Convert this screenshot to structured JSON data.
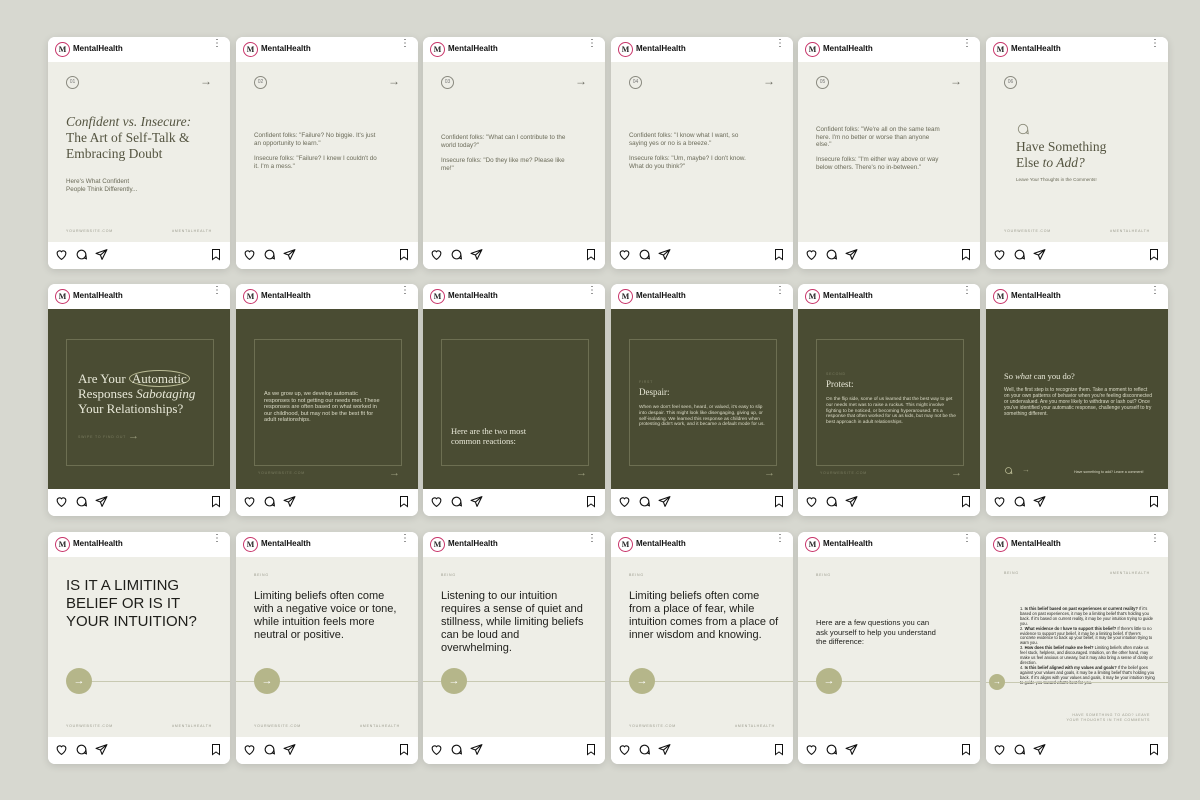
{
  "brand": {
    "avatar_letter": "M",
    "username": "MentalHealth",
    "kebab": "⋮"
  },
  "colors": {
    "background": "#d7d8d0",
    "light_post": "#eeeee7",
    "dark_post": "#4a4c33",
    "accent_circle": "#b5b68a",
    "avatar_ring": "#c8356a"
  },
  "icons": [
    "heart-icon",
    "comment-icon",
    "share-icon",
    "bookmark-icon"
  ],
  "row1": {
    "c1": {
      "num": "01",
      "arrow": "→",
      "title1": "Confident vs. Insecure:",
      "title2": "The Art of Self-Talk &",
      "title3": "Embracing Doubt",
      "sub1": "Here's What Confident",
      "sub2": "People Think Differently...",
      "foot_l": "YOURWEBSITE.COM",
      "foot_r": "#MENTALHEALTH"
    },
    "c2": {
      "num": "02",
      "arrow": "→",
      "p1": "Confident folks: \"Failure? No biggie. It's just an opportunity to learn.\"",
      "p2": "Insecure folks: \"Failure? I knew I couldn't do it. I'm a mess.\""
    },
    "c3": {
      "num": "03",
      "arrow": "→",
      "p1": "Confident folks: \"What can I contribute to the world today?\"",
      "p2": "Insecure folks: \"Do they like me? Please like me!\""
    },
    "c4": {
      "num": "04",
      "arrow": "→",
      "p1": "Confident folks: \"I know what I want, so saying yes or no is a breeze.\"",
      "p2": "Insecure folks: \"Um, maybe? I don't know. What do you think?\""
    },
    "c5": {
      "num": "05",
      "arrow": "→",
      "p1": "Confident folks: \"We're all on the same team here. I'm no better or worse than anyone else.\"",
      "p2": "Insecure folks: \"I'm either way above or way below others. There's no in-between.\""
    },
    "c6": {
      "num": "06",
      "title1": "Have Something",
      "title2": "Else ",
      "title2i": "to Add?",
      "sub": "Leave Your Thoughts in the Comments!",
      "foot_l": "YOURWEBSITE.COM",
      "foot_r": "#MENTALHEALTH"
    }
  },
  "row2": {
    "c1": {
      "t1": "Are Your ",
      "t1a": "Automatic",
      "t2": "Responses ",
      "t2i": "Sabotaging",
      "t3": "Your Relationships?",
      "swipe": "SWIPE TO FIND OUT",
      "arrow": "→"
    },
    "c2": {
      "p": "As we grow up, we develop automatic responses to not getting our needs met. These responses are often based on what worked in our childhood, but may not be the best fit for adult relationships.",
      "foot": "YOURWEBSITE.COM",
      "arrow": "→"
    },
    "c3": {
      "t1": "Here are the two most",
      "t2": "common reactions:",
      "arrow": "→"
    },
    "c4": {
      "label": "FIRST",
      "title": "Despair:",
      "p": "When we don't feel seen, heard, or valued, it's easy to slip into despair. This might look like disengaging, giving up, or self-isolating. We learned this response as children when protesting didn't work, and it became a default mode for us.",
      "arrow": "→"
    },
    "c5": {
      "label": "SECOND",
      "title": "Protest:",
      "p": "On the flip side, some of us learned that the best way to get our needs met was to raise a ruckus. This might involve fighting to be noticed, or becoming hyperaroused. It's a response that often worked for us as kids, but may not be the best approach in adult relationships.",
      "foot": "YOURWEBSITE.COM",
      "arrow": "→"
    },
    "c6": {
      "title": "So ",
      "title_i": "what",
      "title2": " can you do?",
      "p": "Well, the first step is to recognize them. Take a moment to reflect on your own patterns of behavior when you're feeling disconnected or undervalued. Are you more likely to withdraw or lash out? Once you've identified your automatic response, challenge yourself to try something different.",
      "foot": "Have something to add? Leave a comment!",
      "arrow": "→"
    }
  },
  "row3": {
    "c1": {
      "l1": "IS IT A LIMITING",
      "l2": "BELIEF OR IS IT",
      "l3": "YOUR INTUITION?",
      "arrow": "→",
      "foot_l": "YOURWEBSITE.COM",
      "foot_r": "#MENTALHEALTH"
    },
    "c2": {
      "tag": "BEING",
      "p": "Limiting beliefs often come with a negative voice or tone, while intuition feels more neutral or positive.",
      "arrow": "→",
      "foot_l": "YOURWEBSITE.COM",
      "foot_r": "#MENTALHEALTH"
    },
    "c3": {
      "tag": "BEING",
      "p": "Listening to our intuition requires a sense of quiet and stillness, while limiting beliefs can be loud and overwhelming.",
      "arrow": "→"
    },
    "c4": {
      "tag": "BEING",
      "p": "Limiting beliefs often come from a place of fear, while intuition comes from a place of inner wisdom and knowing.",
      "arrow": "→",
      "foot_l": "YOURWEBSITE.COM",
      "foot_r": "#MENTALHEALTH"
    },
    "c5": {
      "tag": "BEING",
      "p": "Here are a few questions you can ask yourself to help you understand the difference:",
      "arrow": "→"
    },
    "c6": {
      "tag": "BEING",
      "tag_r": "#MENTALHEALTH",
      "q1b": "Is this belief based on past experiences or current reality?",
      "q1": " If it's based on past experiences, it may be a limiting belief that's holding you back. If it's based on current reality, it may be your intuition trying to guide you.",
      "q2b": "What evidence do I have to support this belief?",
      "q2": " If there's little to no evidence to support your belief, it may be a limiting belief. If there's concrete evidence to back up your belief, it may be your intuition trying to warn you.",
      "q3b": "How does this belief make me feel?",
      "q3": " Limiting beliefs often make us feel stuck, helpless, and discouraged. Intuition, on the other hand, may make us feel anxious or uneasy, but it may also bring a sense of clarity or direction.",
      "q4b": "Is this belief aligned with my values and goals?",
      "q4": " If the belief goes against your values and goals, it may be a limiting belief that's holding you back. If it's aligns with your values and goals, it may be your intuition trying to guide you toward what's best for you.",
      "arrow": "→",
      "foot1": "HAVE SOMETHING TO ADD? LEAVE",
      "foot2": "YOUR THOUGHTS IN THE COMMENTS"
    }
  }
}
